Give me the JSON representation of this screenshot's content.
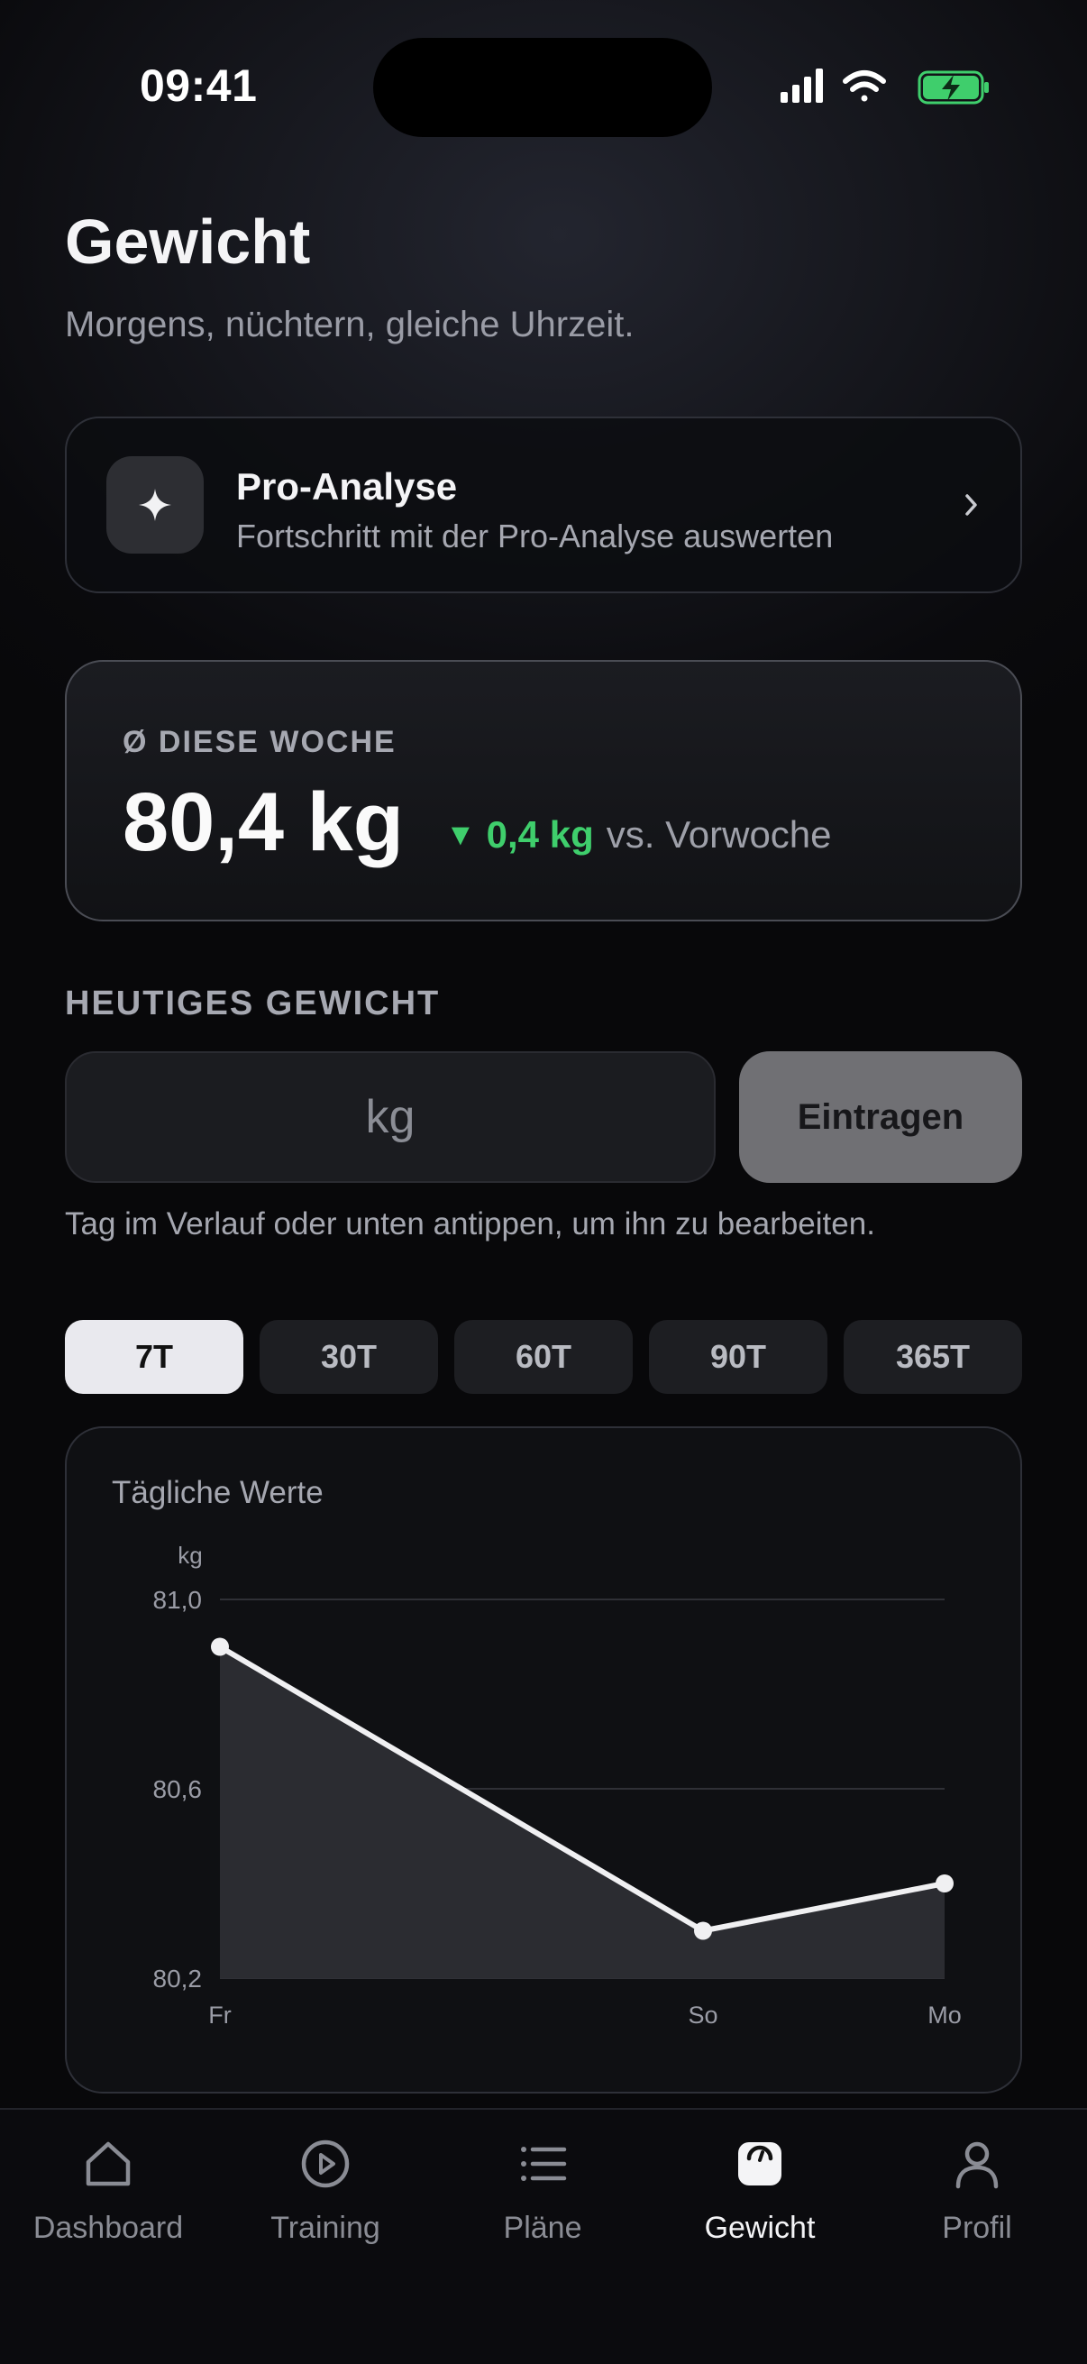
{
  "status": {
    "time": "09:41"
  },
  "header": {
    "title": "Gewicht",
    "subtitle": "Morgens, nüchtern, gleiche Uhrzeit."
  },
  "pro_card": {
    "title": "Pro-Analyse",
    "subtitle": "Fortschritt mit der Pro-Analyse auswerten",
    "icon": "sparkle-icon"
  },
  "weekly_avg": {
    "label": "Ø DIESE WOCHE",
    "value": "80,4 kg",
    "delta_arrow": "▼",
    "delta": "0,4 kg",
    "delta_suffix": "vs. Vorwoche",
    "delta_color": "#3fce6c"
  },
  "entry": {
    "section_label": "HEUTIGES GEWICHT",
    "placeholder": "kg",
    "value": "",
    "button_label": "Eintragen",
    "hint": "Tag im Verlauf oder unten antippen, um ihn zu bearbeiten."
  },
  "range_tabs": [
    {
      "label": "7T",
      "active": true
    },
    {
      "label": "30T",
      "active": false
    },
    {
      "label": "60T",
      "active": false
    },
    {
      "label": "90T",
      "active": false
    },
    {
      "label": "365T",
      "active": false
    }
  ],
  "chart_data": {
    "type": "area",
    "title": "Tägliche Werte",
    "ylabel": "kg",
    "x": [
      "Fr",
      "So",
      "Mo"
    ],
    "x_index": [
      0,
      2,
      3
    ],
    "series": [
      {
        "values": [
          80.9,
          80.3,
          80.4
        ]
      }
    ],
    "ylim": [
      80.2,
      81.0
    ],
    "yticks": [
      "81,0",
      "80,6",
      "80,2"
    ],
    "ytick_values": [
      81.0,
      80.6,
      80.2
    ],
    "grid": true,
    "line_color": "#f0f0f2",
    "fill_color": "#2b2c31"
  },
  "nav": {
    "items": [
      {
        "label": "Dashboard",
        "icon": "home-icon",
        "active": false
      },
      {
        "label": "Training",
        "icon": "play-circle-icon",
        "active": false
      },
      {
        "label": "Pläne",
        "icon": "list-icon",
        "active": false
      },
      {
        "label": "Gewicht",
        "icon": "scale-icon",
        "active": true
      },
      {
        "label": "Profil",
        "icon": "person-icon",
        "active": false
      }
    ]
  }
}
